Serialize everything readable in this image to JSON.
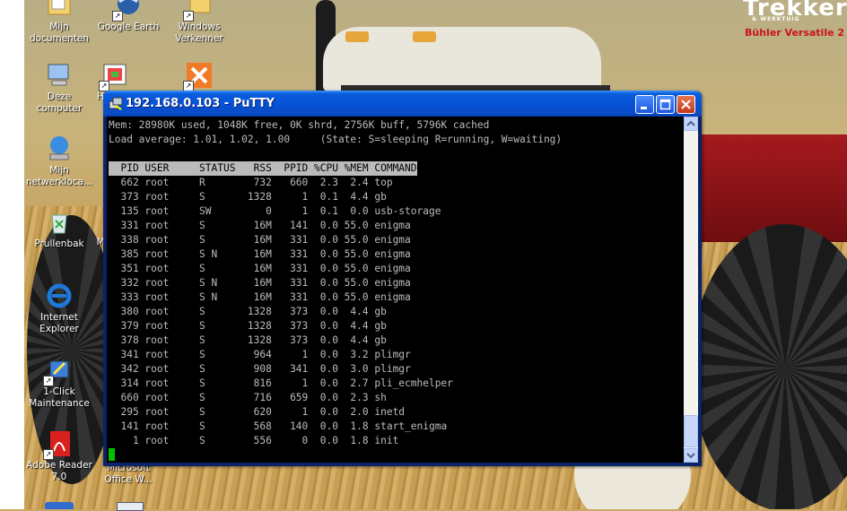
{
  "desktop": {
    "icons": [
      {
        "label": "Mijn documenten"
      },
      {
        "label": "Google Earth"
      },
      {
        "label": "Windows Verkenner"
      },
      {
        "label": "Deze computer"
      },
      {
        "label": "H"
      },
      {
        "label": "Mijn netwerkloca..."
      },
      {
        "label": "Prullenbak"
      },
      {
        "label": "M"
      },
      {
        "label": "Internet Explorer"
      },
      {
        "label": "1-Click Maintenance"
      },
      {
        "label": "Adobe Reader 7.0"
      },
      {
        "label": "Microsoft Office W..."
      }
    ],
    "wallpaper": {
      "brand": "Trekker",
      "brand_tag": "& WERKTUIG",
      "brand_sub": "Bühler Versatile 2"
    }
  },
  "window": {
    "title": "192.168.0.103 - PuTTY",
    "colors": {
      "title_bar": "#0552d6",
      "terminal_bg": "#000000",
      "terminal_fg": "#bbbbbb",
      "cursor": "#00c000",
      "close_button": "#c4361a"
    }
  },
  "terminal": {
    "lines": [
      "Mem: 28980K used, 1048K free, 0K shrd, 2756K buff, 5796K cached",
      "Load average: 1.01, 1.02, 1.00     (State: S=sleeping R=running, W=waiting)",
      "",
      "  PID USER     STATUS   RSS  PPID %CPU %MEM COMMAND",
      "  662 root     R        732   660  2.3  2.4 top",
      "  373 root     S       1328     1  0.1  4.4 gb",
      "  135 root     SW         0     1  0.1  0.0 usb-storage",
      "  331 root     S        16M   141  0.0 55.0 enigma",
      "  338 root     S        16M   331  0.0 55.0 enigma",
      "  385 root     S N      16M   331  0.0 55.0 enigma",
      "  351 root     S        16M   331  0.0 55.0 enigma",
      "  332 root     S N      16M   331  0.0 55.0 enigma",
      "  333 root     S N      16M   331  0.0 55.0 enigma",
      "  380 root     S       1328   373  0.0  4.4 gb",
      "  379 root     S       1328   373  0.0  4.4 gb",
      "  378 root     S       1328   373  0.0  4.4 gb",
      "  341 root     S        964     1  0.0  3.2 plimgr",
      "  342 root     S        908   341  0.0  3.0 plimgr",
      "  314 root     S        816     1  0.0  2.7 pli_ecmhelper",
      "  660 root     S        716   659  0.0  2.3 sh",
      "  295 root     S        620     1  0.0  2.0 inetd",
      "  141 root     S        568   140  0.0  1.8 start_enigma",
      "    1 root     S        556     0  0.0  1.8 init"
    ]
  }
}
